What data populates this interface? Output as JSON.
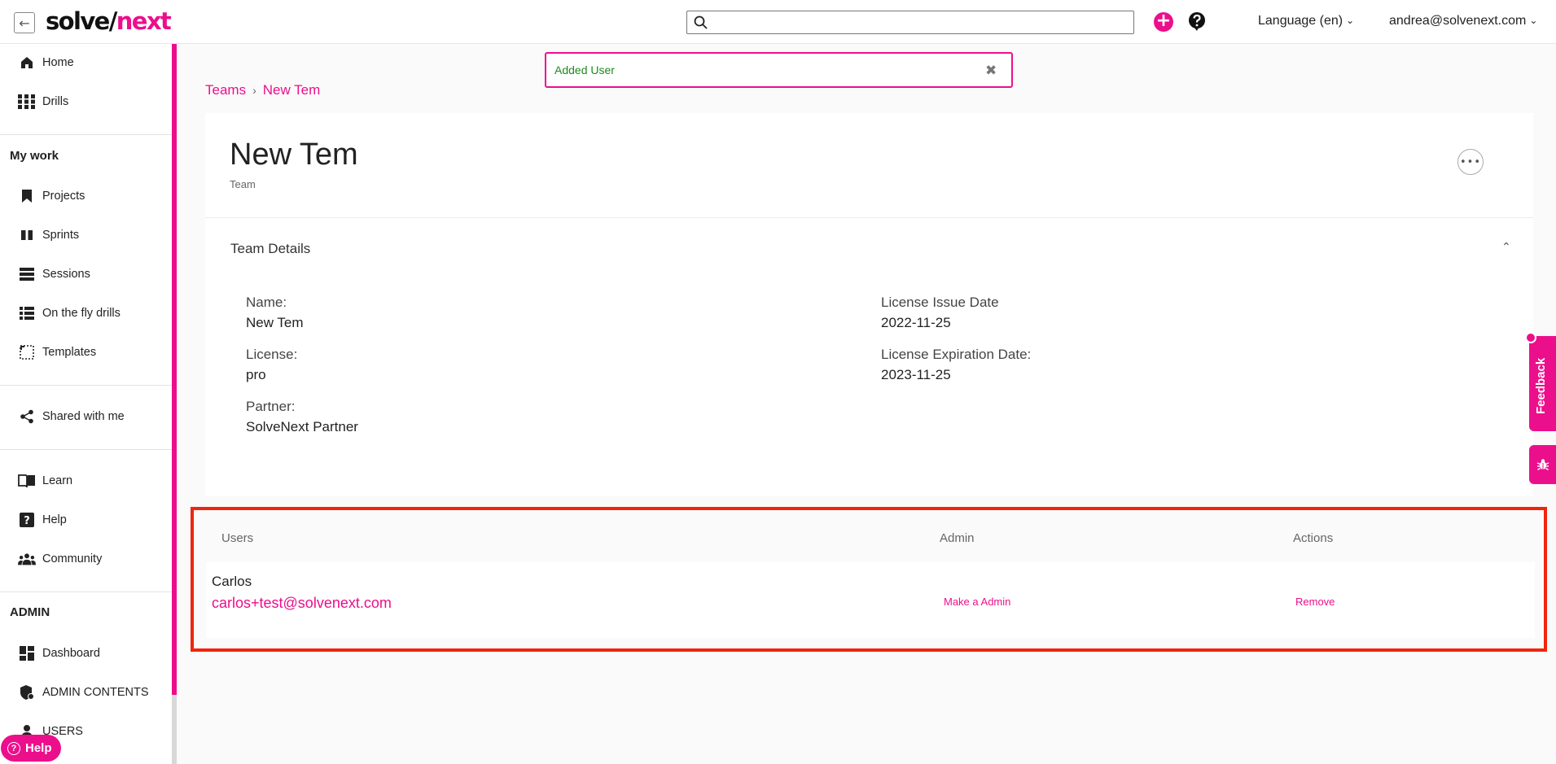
{
  "header": {
    "logo_solve": "solve/",
    "logo_next": "next",
    "search_placeholder": "",
    "language": "Language (en)",
    "user_email": "andrea@solvenext.com"
  },
  "sidebar": {
    "top_items": [
      {
        "label": "Home",
        "icon": "home-icon"
      },
      {
        "label": "Drills",
        "icon": "grid-icon"
      }
    ],
    "my_work_title": "My work",
    "my_work_items": [
      {
        "label": "Projects",
        "icon": "bookmark-icon"
      },
      {
        "label": "Sprints",
        "icon": "sprints-icon"
      },
      {
        "label": "Sessions",
        "icon": "sessions-icon"
      },
      {
        "label": "On the fly drills",
        "icon": "list-icon"
      },
      {
        "label": "Templates",
        "icon": "templates-icon"
      }
    ],
    "shared": {
      "label": "Shared with me",
      "icon": "share-icon"
    },
    "support_items": [
      {
        "label": "Learn",
        "icon": "book-icon"
      },
      {
        "label": "Help",
        "icon": "help-icon"
      },
      {
        "label": "Community",
        "icon": "community-icon"
      }
    ],
    "admin_title": "ADMIN",
    "admin_items": [
      {
        "label": "Dashboard",
        "icon": "dashboard-icon"
      },
      {
        "label": "ADMIN CONTENTS",
        "icon": "shield-icon"
      },
      {
        "label": "USERS",
        "icon": "users-icon"
      }
    ],
    "help_pill": "Help"
  },
  "toast": {
    "message": "Added User"
  },
  "breadcrumb": {
    "root": "Teams",
    "current": "New Tem"
  },
  "team": {
    "title": "New Tem",
    "subtitle": "Team",
    "details_title": "Team Details",
    "fields": {
      "name_label": "Name:",
      "name_value": "New Tem",
      "license_label": "License:",
      "license_value": "pro",
      "partner_label": "Partner:",
      "partner_value": "SolveNext Partner",
      "issue_label": "License Issue Date",
      "issue_value": "2022-11-25",
      "expiry_label": "License Expiration Date:",
      "expiry_value": "2023-11-25"
    }
  },
  "users_table": {
    "headers": [
      "Users",
      "Admin",
      "Actions"
    ],
    "rows": [
      {
        "name": "Carlos",
        "email": "carlos+test@solvenext.com",
        "admin_action": "Make a Admin",
        "action": "Remove"
      }
    ]
  },
  "feedback": {
    "label": "Feedback"
  },
  "colors": {
    "brand": "#ec0f8c",
    "highlight": "#f0250d",
    "success": "#1d8a1d"
  }
}
